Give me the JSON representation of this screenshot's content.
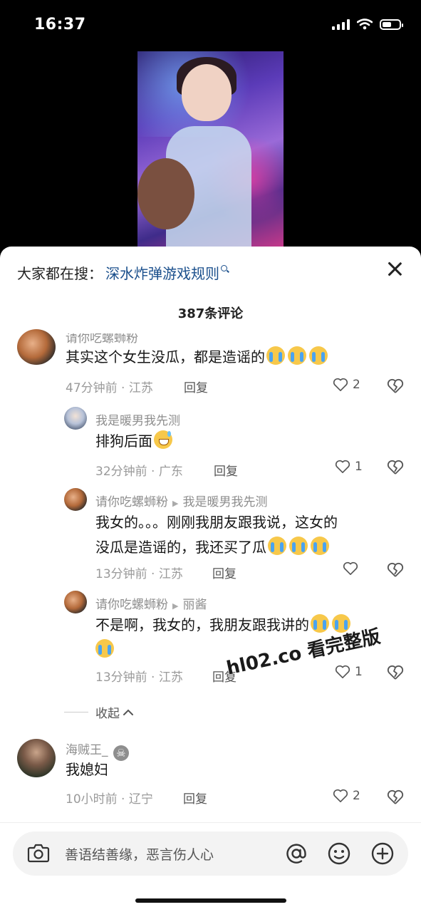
{
  "status_bar": {
    "time": "16:37"
  },
  "search": {
    "prefix": "大家都在搜：",
    "term": "深水炸弹游戏规则"
  },
  "comments_count": "387条评论",
  "comments": [
    {
      "user": "请你吃螺蛳粉",
      "text": "其实这个女生没瓜，都是造谣的",
      "emojis": [
        "loudly-crying-face",
        "loudly-crying-face",
        "loudly-crying-face"
      ],
      "time_location": "47分钟前 · 江苏",
      "reply_label": "回复",
      "likes": "2"
    },
    {
      "user": "我是暖男我先测",
      "text": "排狗后面",
      "emojis": [
        "grinning-sweat-face"
      ],
      "time_location": "32分钟前 · 广东",
      "reply_label": "回复",
      "likes": "1"
    },
    {
      "user": "请你吃螺蛳粉",
      "reply_to": "我是暖男我先测",
      "text_line1": "我女的。。。刚刚我朋友跟我说，这女的",
      "text_line2": "没瓜是造谣的，我还买了瓜",
      "emojis": [
        "loudly-crying-face",
        "loudly-crying-face",
        "loudly-crying-face"
      ],
      "time_location": "13分钟前 · 江苏",
      "reply_label": "回复",
      "likes": ""
    },
    {
      "user": "请你吃螺蛳粉",
      "reply_to": "丽酱",
      "text": "不是啊，我女的，我朋友跟我讲的",
      "emojis": [
        "loudly-crying-face",
        "loudly-crying-face",
        "loudly-crying-face"
      ],
      "time_location": "13分钟前 · 江苏",
      "reply_label": "回复",
      "likes": "1"
    },
    {
      "user": "海贼王_",
      "user_badge_icon": "skull-crossbones-icon",
      "text": "我媳妇",
      "time_location": "10小时前 · 辽宁",
      "reply_label": "回复",
      "likes": "2"
    }
  ],
  "collapse_label": "收起",
  "watermark": "hl02.co 看完整版",
  "input": {
    "placeholder": "善语结善缘，恶言伤人心"
  },
  "colors": {
    "link": "#1a4f8c",
    "sheet_bg": "#ffffff",
    "input_bg": "#f3f3f3"
  }
}
